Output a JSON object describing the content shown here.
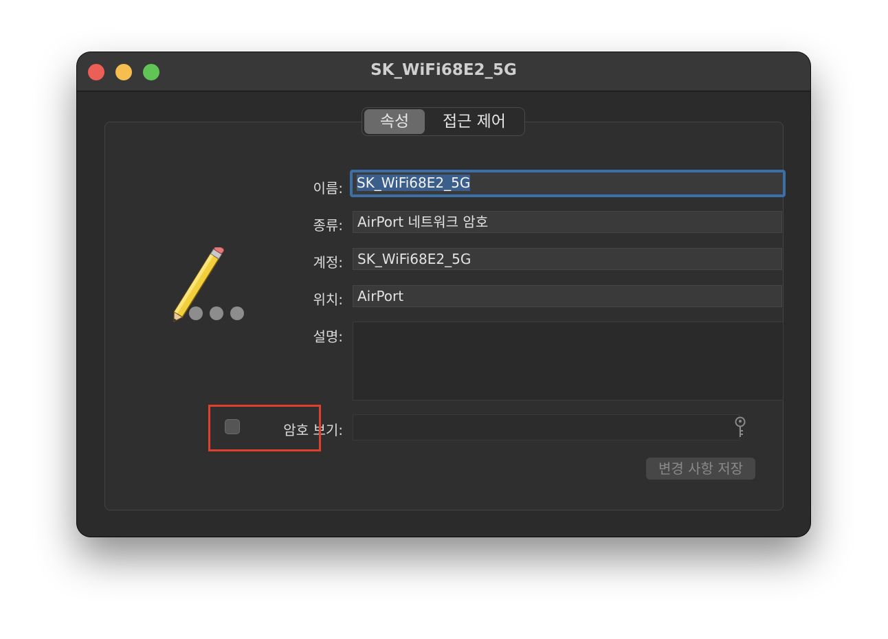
{
  "window": {
    "title": "SK_WiFi68E2_5G"
  },
  "tabs": [
    {
      "label": "속성",
      "active": true
    },
    {
      "label": "접근 제어",
      "active": false
    }
  ],
  "form": {
    "name_label": "이름:",
    "name_value": "SK_WiFi68E2_5G",
    "kind_label": "종류:",
    "kind_value": "AirPort 네트워크 암호",
    "account_label": "계정:",
    "account_value": "SK_WiFi68E2_5G",
    "where_label": "위치:",
    "where_value": "AirPort",
    "comments_label": "설명:",
    "comments_value": "",
    "show_password_label": "암호 보기:",
    "show_password_checked": false,
    "password_value": ""
  },
  "buttons": {
    "save_label": "변경 사항 저장"
  },
  "icons": {
    "app": "pencil-password-icon",
    "key": "key-icon"
  },
  "colors": {
    "focus_ring": "#3a6fa8",
    "highlight": "#e0402c",
    "close": "#ec5f57",
    "minimize": "#f5be4f",
    "maximize": "#61c555"
  }
}
